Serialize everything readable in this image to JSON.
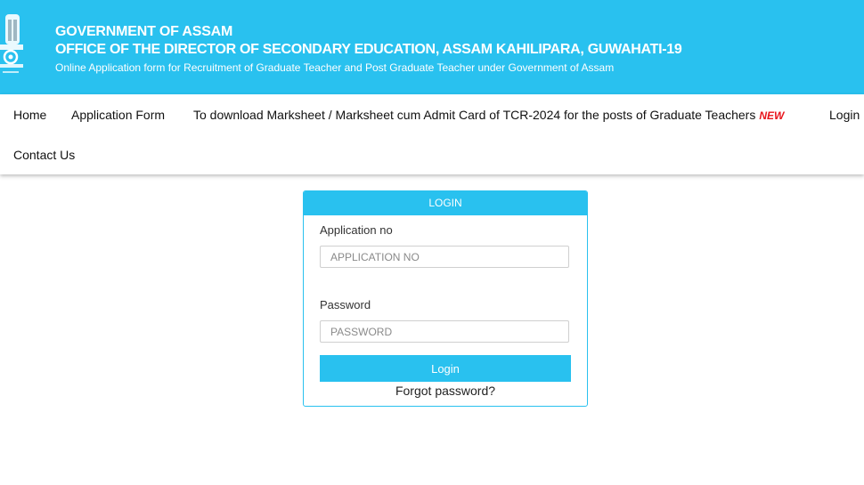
{
  "header": {
    "line1": "GOVERNMENT OF ASSAM",
    "line2": "OFFICE OF THE DIRECTOR OF SECONDARY EDUCATION, ASSAM KAHILIPARA, GUWAHATI-19",
    "line3": "Online Application form for Recruitment of Graduate Teacher and Post Graduate Teacher under Government of Assam"
  },
  "emblem": {
    "icon": "state-emblem-icon"
  },
  "nav": {
    "home": "Home",
    "application_form": "Application Form",
    "marksheet": "To download Marksheet / Marksheet cum Admit Card of TCR-2024 for the posts of Graduate Teachers",
    "new_badge": "NEW",
    "login": "Login",
    "contact": "Contact Us"
  },
  "login_card": {
    "title": "LOGIN",
    "application_label": "Application no",
    "application_placeholder": "APPLICATION NO",
    "application_value": "",
    "password_label": "Password",
    "password_placeholder": "PASSWORD",
    "password_value": "",
    "submit_label": "Login",
    "forgot_label": "Forgot password?"
  },
  "colors": {
    "accent": "#29c1ef",
    "new_badge": "#e8141b",
    "header_text": "#ffffff"
  }
}
